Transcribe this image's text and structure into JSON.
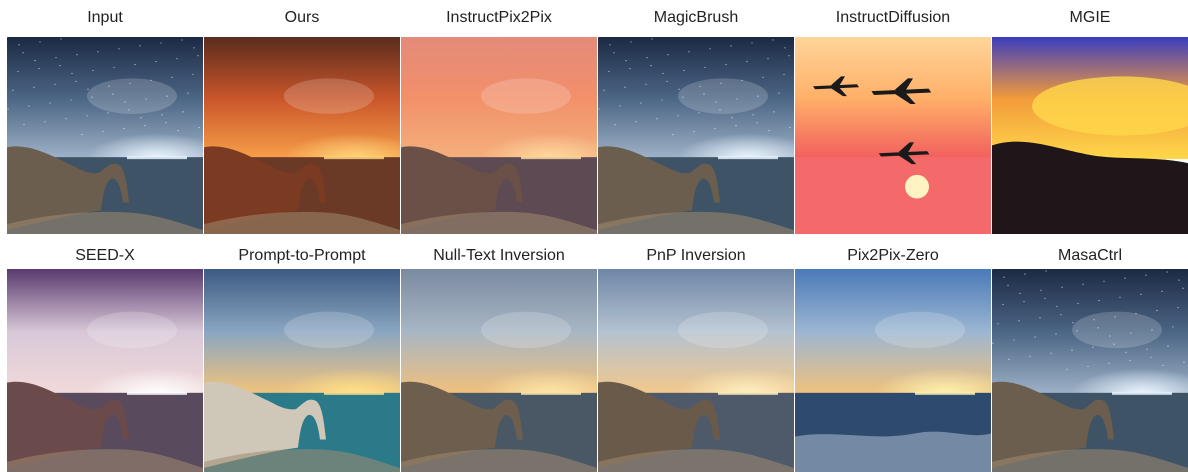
{
  "rows": [
    {
      "cells": [
        {
          "label": "Input",
          "scene": "night"
        },
        {
          "label": "Ours",
          "scene": "sunset-orange"
        },
        {
          "label": "InstructPix2Pix",
          "scene": "sunset-pink"
        },
        {
          "label": "MagicBrush",
          "scene": "night"
        },
        {
          "label": "InstructDiffusion",
          "scene": "planes"
        },
        {
          "label": "MGIE",
          "scene": "mgie"
        }
      ]
    },
    {
      "cells": [
        {
          "label": "SEED-X",
          "scene": "seedx"
        },
        {
          "label": "Prompt-to-Prompt",
          "scene": "p2p"
        },
        {
          "label": "Null-Text Inversion",
          "scene": "dusk-soft"
        },
        {
          "label": "PnP Inversion",
          "scene": "dusk-soft2"
        },
        {
          "label": "Pix2Pix-Zero",
          "scene": "clouds-ocean"
        },
        {
          "label": "MasaCtrl",
          "scene": "night"
        }
      ]
    }
  ],
  "palette": {
    "night": {
      "sky_top": "#1b2a44",
      "sky_mid": "#4b6584",
      "sky_low": "#9fb3c8",
      "sea": "#3f5366",
      "cliff": "#6b5e4e",
      "sun": "#eaf4ff"
    },
    "sunset-orange": {
      "sky_top": "#5a2c1e",
      "sky_mid": "#c9552a",
      "sky_low": "#f7a04a",
      "sea": "#6a3a26",
      "cliff": "#7a3b22",
      "sun": "#ffd37a"
    },
    "sunset-pink": {
      "sky_top": "#e48a7a",
      "sky_mid": "#f2906a",
      "sky_low": "#f4b07c",
      "sea": "#5e4a52",
      "cliff": "#6b5048",
      "sun": "#ffd8a0"
    },
    "planes": {
      "sky_top": "#ffd59a",
      "sky_mid": "#ffb068",
      "sky_low": "#f25e5e",
      "sea": "#f46a6a",
      "cliff": "#1a1a1a",
      "sun": "#fff3c4"
    },
    "mgie": {
      "sky_top": "#3a3dc0",
      "sky_mid": "#f29a3a",
      "sky_low": "#ffd84a",
      "sea": "#2a1e2a",
      "cliff": "#1e1618",
      "sun": "#ffe98a"
    },
    "seedx": {
      "sky_top": "#5a3a6e",
      "sky_mid": "#d8c8d8",
      "sky_low": "#f2dada",
      "sea": "#5a4a5e",
      "cliff": "#6a4a4a",
      "sun": "#ffffff"
    },
    "p2p": {
      "sky_top": "#3c5a82",
      "sky_mid": "#8aa6c2",
      "sky_low": "#f4c47a",
      "sea": "#2a7a8a",
      "cliff": "#cfc8b8",
      "sun": "#ffe08a"
    },
    "dusk-soft": {
      "sky_top": "#7a8aa0",
      "sky_mid": "#a8b6c4",
      "sky_low": "#f2c07a",
      "sea": "#4a5866",
      "cliff": "#6e5e4e",
      "sun": "#ffe6a8"
    },
    "dusk-soft2": {
      "sky_top": "#6e86a6",
      "sky_mid": "#b4c2d0",
      "sky_low": "#f4c88a",
      "sea": "#4e5a6a",
      "cliff": "#6a5a4a",
      "sun": "#fff0c0"
    },
    "clouds-ocean": {
      "sky_top": "#4a7ab8",
      "sky_mid": "#9cb6d2",
      "sky_low": "#f2c27a",
      "sea": "#2e4a6e",
      "cliff": "#9a8a6a",
      "sun": "#fff2b0"
    }
  }
}
